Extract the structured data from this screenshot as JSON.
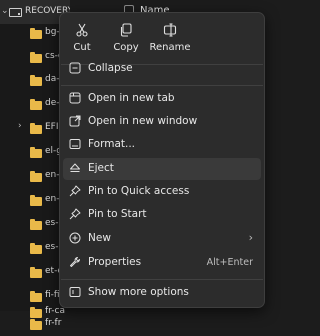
{
  "tree": {
    "root": "RECOVERY (D:)",
    "items": [
      "bg-b",
      "cs-c",
      "da-d",
      "de-d",
      "EFI",
      "el-g",
      "en-g",
      "en-u",
      "es-e",
      "es-m",
      "et-e",
      "fi-fi",
      "fr-ca",
      "fr-fr"
    ]
  },
  "header": {
    "name": "Name"
  },
  "menu": {
    "quick_actions": [
      {
        "label": "Cut",
        "icon": "cut-icon"
      },
      {
        "label": "Copy",
        "icon": "copy-icon"
      },
      {
        "label": "Rename",
        "icon": "rename-icon"
      }
    ],
    "items": [
      {
        "label": "Collapse",
        "icon": "collapse-icon"
      },
      {
        "label": "Open in new tab",
        "icon": "new-tab-icon"
      },
      {
        "label": "Open in new window",
        "icon": "new-window-icon"
      },
      {
        "label": "Format...",
        "icon": "format-icon"
      },
      {
        "label": "Eject",
        "icon": "eject-icon"
      },
      {
        "label": "Pin to Quick access",
        "icon": "pin-icon"
      },
      {
        "label": "Pin to Start",
        "icon": "pin-icon"
      },
      {
        "label": "New",
        "icon": "new-icon"
      },
      {
        "label": "Properties",
        "icon": "properties-icon",
        "shortcut": "Alt+Enter"
      },
      {
        "label": "Show more options",
        "icon": "more-options-icon"
      }
    ]
  },
  "colors": {
    "folder": "#e9b949",
    "menu_bg": "#2c2c2c",
    "hover": "#3a3a3a",
    "background": "#1c1c1c"
  }
}
